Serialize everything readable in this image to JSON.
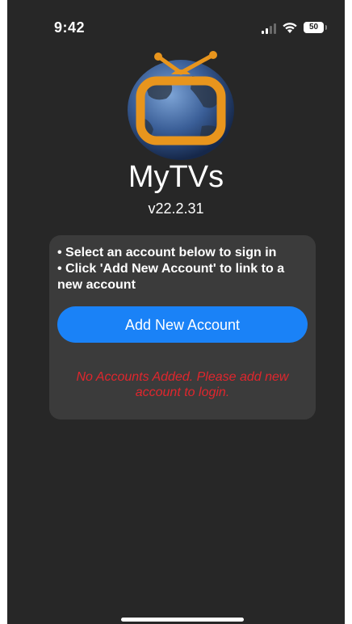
{
  "status_bar": {
    "time": "9:42",
    "battery_level": "50",
    "icons": [
      "cellular-signal-icon",
      "wifi-icon",
      "battery-icon"
    ]
  },
  "app": {
    "logo_icon": "globe-tv-logo-icon",
    "title": "MyTVs",
    "version": "v22.2.31"
  },
  "card": {
    "instructions": [
      "• Select an account below to sign in",
      "• Click 'Add New Account' to link to a new account"
    ],
    "add_button_label": "Add New Account",
    "error_message": "No Accounts Added. Please add new account to login."
  },
  "colors": {
    "background": "#272727",
    "card": "#3b3b3b",
    "accent": "#1a82f7",
    "error": "#e0262d",
    "logo_orange": "#e8951d"
  }
}
